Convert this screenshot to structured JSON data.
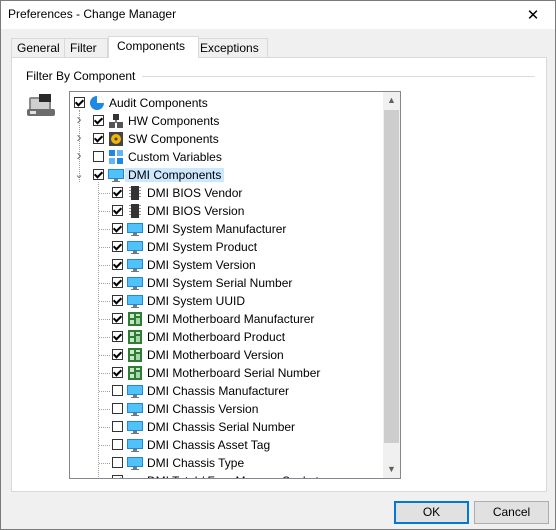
{
  "window": {
    "title": "Preferences - Change Manager",
    "close_glyph": "✕"
  },
  "tabs": [
    {
      "label": "General",
      "active": false
    },
    {
      "label": "Filter",
      "active": false
    },
    {
      "label": "Components",
      "active": true
    },
    {
      "label": "Exceptions",
      "active": false
    }
  ],
  "group": {
    "label": "Filter By Component"
  },
  "tree": {
    "items": [
      {
        "label": "Audit Components",
        "checked": true,
        "icon": "audit-pie-icon",
        "expander": ""
      },
      {
        "label": "HW Components",
        "checked": true,
        "icon": "hardware-icon",
        "expander": "›"
      },
      {
        "label": "SW Components",
        "checked": true,
        "icon": "software-disc-icon",
        "expander": "›"
      },
      {
        "label": "Custom Variables",
        "checked": false,
        "icon": "custom-variables-icon",
        "expander": "›"
      },
      {
        "label": "DMI Components",
        "checked": true,
        "icon": "monitor-icon",
        "expander": "⌄",
        "selected": true
      },
      {
        "label": "DMI BIOS Vendor",
        "checked": true,
        "icon": "chip-icon"
      },
      {
        "label": "DMI BIOS Version",
        "checked": true,
        "icon": "chip-icon"
      },
      {
        "label": "DMI System Manufacturer",
        "checked": true,
        "icon": "monitor-icon"
      },
      {
        "label": "DMI System Product",
        "checked": true,
        "icon": "monitor-icon"
      },
      {
        "label": "DMI System Version",
        "checked": true,
        "icon": "monitor-icon"
      },
      {
        "label": "DMI System Serial Number",
        "checked": true,
        "icon": "monitor-icon"
      },
      {
        "label": "DMI System UUID",
        "checked": true,
        "icon": "monitor-icon"
      },
      {
        "label": "DMI Motherboard Manufacturer",
        "checked": true,
        "icon": "motherboard-icon"
      },
      {
        "label": "DMI Motherboard Product",
        "checked": true,
        "icon": "motherboard-icon"
      },
      {
        "label": "DMI Motherboard Version",
        "checked": true,
        "icon": "motherboard-icon"
      },
      {
        "label": "DMI Motherboard Serial Number",
        "checked": true,
        "icon": "motherboard-icon"
      },
      {
        "label": "DMI Chassis Manufacturer",
        "checked": false,
        "icon": "chassis-icon"
      },
      {
        "label": "DMI Chassis Version",
        "checked": false,
        "icon": "chassis-icon"
      },
      {
        "label": "DMI Chassis Serial Number",
        "checked": false,
        "icon": "chassis-icon"
      },
      {
        "label": "DMI Chassis Asset Tag",
        "checked": false,
        "icon": "chassis-icon"
      },
      {
        "label": "DMI Chassis Type",
        "checked": false,
        "icon": "chassis-icon"
      },
      {
        "label": "DMI Total / Free Memory Sockets",
        "checked": true,
        "icon": "memory-icon"
      }
    ]
  },
  "buttons": {
    "ok": "OK",
    "cancel": "Cancel"
  },
  "colors": {
    "selection": "#cce8ff",
    "accent": "#0078d7"
  }
}
